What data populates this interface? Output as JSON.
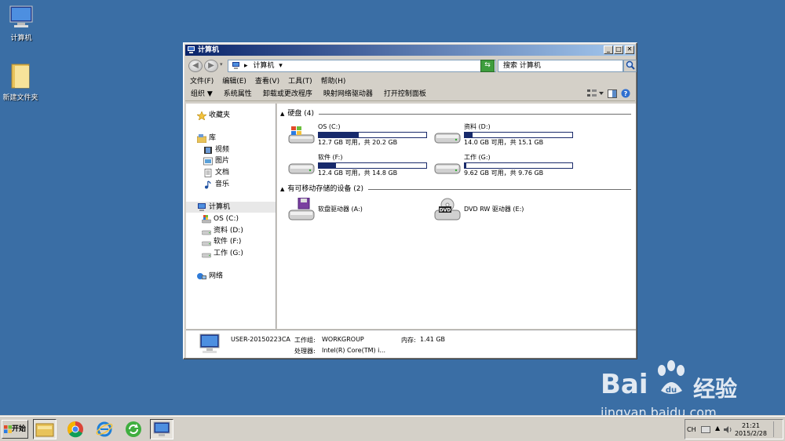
{
  "desktop": {
    "icons": [
      {
        "label": "计算机"
      },
      {
        "label": "新建文件夹"
      }
    ]
  },
  "window": {
    "title": "计算机",
    "address": "计算机",
    "search_placeholder": "搜索 计算机",
    "menu": [
      "文件(F)",
      "编辑(E)",
      "查看(V)",
      "工具(T)",
      "帮助(H)"
    ],
    "toolbar": [
      "组织 ▼",
      "系统属性",
      "卸载或更改程序",
      "映射网络驱动器",
      "打开控制面板"
    ],
    "sidebar": {
      "favorites": "收藏夹",
      "libraries": "库",
      "lib_items": [
        "视频",
        "图片",
        "文档",
        "音乐"
      ],
      "computer": "计算机",
      "drives": [
        "OS (C:)",
        "资料 (D:)",
        "软件 (F:)",
        "工作 (G:)"
      ],
      "network": "网络"
    },
    "groups": {
      "hard_disks": "硬盘 (4)",
      "removable": "有可移动存储的设备 (2)"
    },
    "drives": [
      {
        "name": "OS (C:)",
        "info": "12.7 GB 可用，共 20.2 GB",
        "used": 0.37
      },
      {
        "name": "资料 (D:)",
        "info": "14.0 GB 可用，共 15.1 GB",
        "used": 0.07
      },
      {
        "name": "软件 (F:)",
        "info": "12.4 GB 可用，共 14.8 GB",
        "used": 0.16
      },
      {
        "name": "工作 (G:)",
        "info": "9.62 GB 可用，共 9.76 GB",
        "used": 0.015
      }
    ],
    "devices": [
      {
        "name": "软盘驱动器 (A:)"
      },
      {
        "name": "DVD RW 驱动器 (E:)"
      }
    ],
    "details": {
      "computer_name": "USER-20150223CA",
      "workgroup_label": "工作组:",
      "workgroup": "WORKGROUP",
      "memory_label": "内存:",
      "memory": "1.41 GB",
      "cpu_label": "处理器:",
      "cpu": "Intel(R) Core(TM) i..."
    }
  },
  "taskbar": {
    "start": "开始",
    "lang": "CH",
    "time": "21:21",
    "date": "2015/2/28"
  },
  "watermark": {
    "brand": "Bai",
    "brand2": "经验",
    "url": "jingyan.baidu.com"
  }
}
